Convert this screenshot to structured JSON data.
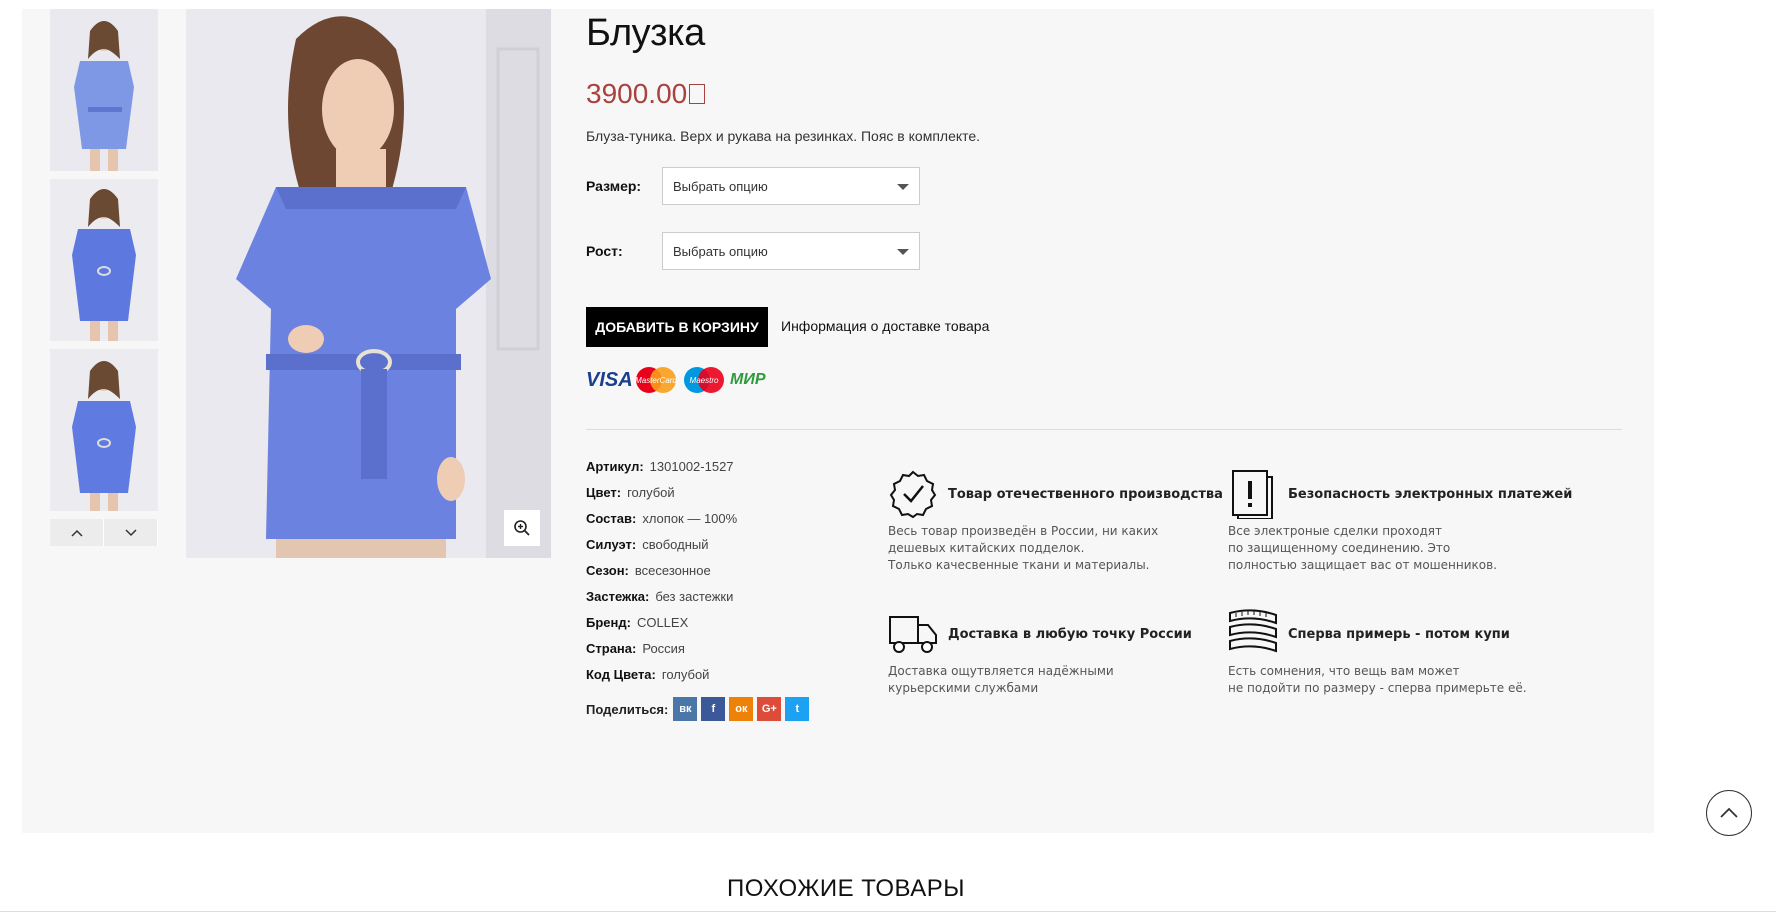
{
  "product": {
    "title": "Блузка",
    "price": "3900.00",
    "description": "Блуза-туника. Верх и рукава на резинках. Пояс в комплекте."
  },
  "options": [
    {
      "label": "Размер:",
      "value": "Выбрать опцию"
    },
    {
      "label": "Рост:",
      "value": "Выбрать опцию"
    }
  ],
  "actions": {
    "add_to_cart": "ДОБАВИТЬ В КОРЗИНУ",
    "delivery_info": "Информация о доставке товара"
  },
  "payment_methods": [
    "VISA",
    "MasterCard",
    "Maestro",
    "МИР"
  ],
  "attributes": [
    {
      "key": "Артикул:",
      "value": "1301002-1527"
    },
    {
      "key": "Цвет:",
      "value": "голубой"
    },
    {
      "key": "Состав:",
      "value": "хлопок — 100%"
    },
    {
      "key": "Силуэт:",
      "value": "свободный"
    },
    {
      "key": "Сезон:",
      "value": "всесезонное"
    },
    {
      "key": "Застежка:",
      "value": "без застежки"
    },
    {
      "key": "Бренд:",
      "value": "COLLEX"
    },
    {
      "key": "Страна:",
      "value": "Россия"
    },
    {
      "key": "Код Цвета:",
      "value": "голубой"
    }
  ],
  "share": {
    "label": "Поделиться:",
    "networks": [
      {
        "name": "vk",
        "glyph": "вк",
        "color": "#4a76a8"
      },
      {
        "name": "facebook",
        "glyph": "f",
        "color": "#3b5998"
      },
      {
        "name": "odnoklassniki",
        "glyph": "ок",
        "color": "#ee8208"
      },
      {
        "name": "google-plus",
        "glyph": "G+",
        "color": "#dd4b39"
      },
      {
        "name": "twitter",
        "glyph": "t",
        "color": "#1da1f2"
      }
    ]
  },
  "features": [
    {
      "icon": "checkmark-badge-icon",
      "title": "Товар отечественного производства",
      "text": "Весь товар произведён в России, ни каких\nдешевых китайских подделок.\nТолько качесвенные ткани и материалы."
    },
    {
      "icon": "exclamation-document-icon",
      "title": "Безопасность электронных платежей",
      "text": "Все электроные сделки проходят\nпо защищенному соединению. Это\nполностью защищает вас от мошенников."
    },
    {
      "icon": "delivery-truck-icon",
      "title": "Доставка в любую точку России",
      "text": "Доставка ощутвляется надёжными\nкурьерскими службами"
    },
    {
      "icon": "measuring-tape-icon",
      "title": "Сперва примерь - потом купи",
      "text": "Есть сомнения, что вещь вам может\nне подойти по размеру - сперва примерьте её."
    }
  ],
  "similar_heading": "ПОХОЖИЕ ТОВАРЫ",
  "colors": {
    "accent_price": "#a8423f",
    "dress_blue": "#6b82e0"
  }
}
